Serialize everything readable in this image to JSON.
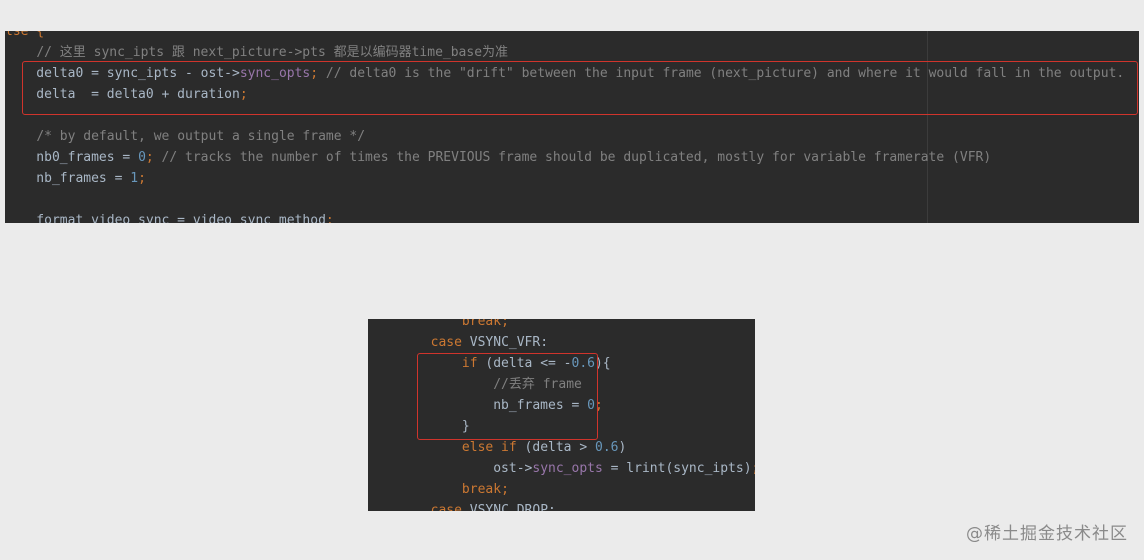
{
  "editor_top": {
    "lines": [
      [
        {
          "t": "lse {",
          "c": "t-kw"
        }
      ],
      [
        {
          "t": "    ",
          "c": "t-plain"
        },
        {
          "t": "// 这里 sync_ipts 跟 next_picture->pts 都是以编码器time_base为准",
          "c": "t-comment"
        }
      ],
      [
        {
          "t": "    delta0 = sync_ipts - ost->",
          "c": "t-plain"
        },
        {
          "t": "sync_opts",
          "c": "t-field"
        },
        {
          "t": "; ",
          "c": "t-punct"
        },
        {
          "t": "// delta0 is the \"drift\" between the input frame (next_picture) and where it would fall in the output.",
          "c": "t-comment"
        }
      ],
      [
        {
          "t": "    delta  = delta0 + duration",
          "c": "t-plain"
        },
        {
          "t": ";",
          "c": "t-punct"
        }
      ],
      [
        {
          "t": "",
          "c": "t-plain"
        }
      ],
      [
        {
          "t": "    ",
          "c": "t-plain"
        },
        {
          "t": "/* by default, we output a single frame */",
          "c": "t-comment"
        }
      ],
      [
        {
          "t": "    nb0_frames = ",
          "c": "t-plain"
        },
        {
          "t": "0",
          "c": "t-num"
        },
        {
          "t": "; ",
          "c": "t-punct"
        },
        {
          "t": "// tracks the number of times the PREVIOUS frame should be duplicated, mostly for variable framerate (VFR)",
          "c": "t-comment"
        }
      ],
      [
        {
          "t": "    nb_frames = ",
          "c": "t-plain"
        },
        {
          "t": "1",
          "c": "t-num"
        },
        {
          "t": ";",
          "c": "t-punct"
        }
      ],
      [
        {
          "t": "",
          "c": "t-plain"
        }
      ],
      [
        {
          "t": "    format_video_sync = video_sync_method",
          "c": "t-plain"
        },
        {
          "t": ";",
          "c": "t-punct"
        }
      ]
    ]
  },
  "editor_bottom": {
    "lines": [
      [
        {
          "t": "            ",
          "c": "t-plain"
        },
        {
          "t": "break",
          "c": "t-kw"
        },
        {
          "t": ";",
          "c": "t-punct"
        }
      ],
      [
        {
          "t": "        ",
          "c": "t-plain"
        },
        {
          "t": "case ",
          "c": "t-kw"
        },
        {
          "t": "VSYNC_VFR:",
          "c": "t-plain"
        }
      ],
      [
        {
          "t": "            ",
          "c": "t-plain"
        },
        {
          "t": "if ",
          "c": "t-kw"
        },
        {
          "t": "(delta <= -",
          "c": "t-plain"
        },
        {
          "t": "0.6",
          "c": "t-num"
        },
        {
          "t": "){",
          "c": "t-plain"
        }
      ],
      [
        {
          "t": "                ",
          "c": "t-plain"
        },
        {
          "t": "//丢弃 frame",
          "c": "t-comment"
        }
      ],
      [
        {
          "t": "                nb_frames = ",
          "c": "t-plain"
        },
        {
          "t": "0",
          "c": "t-num"
        },
        {
          "t": ";",
          "c": "t-punct"
        }
      ],
      [
        {
          "t": "            }",
          "c": "t-plain"
        }
      ],
      [
        {
          "t": "            ",
          "c": "t-plain"
        },
        {
          "t": "else if ",
          "c": "t-kw"
        },
        {
          "t": "(delta > ",
          "c": "t-plain"
        },
        {
          "t": "0.6",
          "c": "t-num"
        },
        {
          "t": ")",
          "c": "t-plain"
        }
      ],
      [
        {
          "t": "                ost->",
          "c": "t-plain"
        },
        {
          "t": "sync_opts",
          "c": "t-field"
        },
        {
          "t": " = lrint(sync_ipts)",
          "c": "t-plain"
        },
        {
          "t": ";",
          "c": "t-punct"
        }
      ],
      [
        {
          "t": "            ",
          "c": "t-plain"
        },
        {
          "t": "break",
          "c": "t-kw"
        },
        {
          "t": ";",
          "c": "t-punct"
        }
      ],
      [
        {
          "t": "        ",
          "c": "t-plain"
        },
        {
          "t": "case ",
          "c": "t-kw"
        },
        {
          "t": "VSYNC_DROP:",
          "c": "t-plain"
        }
      ]
    ]
  },
  "watermark": "@稀土掘金技术社区",
  "colors": {
    "background": "#2b2b2b",
    "plain": "#a9b7c6",
    "keyword": "#cc7832",
    "number": "#6897bb",
    "field": "#9876aa",
    "comment": "#808080",
    "highlight_box": "#d0342c"
  }
}
